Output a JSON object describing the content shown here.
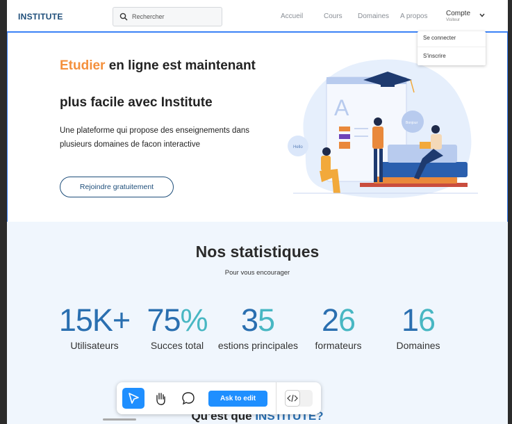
{
  "header": {
    "logo": "INSTITUTE",
    "search_placeholder": "Rechercher",
    "nav": [
      "Accueil",
      "Cours",
      "Domaines",
      "A propos"
    ],
    "account": {
      "title": "Compte",
      "subtitle": "Visiteur"
    },
    "dropdown": [
      "Se connecter",
      "S'inscrire"
    ]
  },
  "hero": {
    "title_accent": "Etudier",
    "title_rest": " en ligne est maintenant",
    "title_line2": "plus facile avec Institute",
    "description": "Une plateforme qui propose des enseignements dans plusieurs domaines de facon interactive",
    "cta": "Rejoindre gratuitement",
    "illustration_bubbles": [
      "Hello",
      "Bonjour"
    ]
  },
  "stats": {
    "title": "Nos statistiques",
    "subtitle": "Pour vous encourager",
    "items": [
      {
        "value_main": "15K+",
        "value_alt": "",
        "label": "Utilisateurs"
      },
      {
        "value_main": "75",
        "value_alt": "%",
        "label": "Succes total"
      },
      {
        "value_main": "3",
        "value_alt": "5",
        "label": "Questions principales"
      },
      {
        "value_main": "2",
        "value_alt": "6",
        "label": "formateurs"
      },
      {
        "value_main": "1",
        "value_alt": "6",
        "label": "Domaines"
      }
    ]
  },
  "next_section": {
    "title_start": "Qu'est que ",
    "title_accent": "INSTITUTE?"
  },
  "toolbar": {
    "ask_label": "Ask to edit",
    "icons": [
      "cursor-icon",
      "hand-icon",
      "comment-icon",
      "code-icon"
    ]
  },
  "colors": {
    "accent_orange": "#f4903c",
    "brand_blue": "#1e4e7a",
    "stat_blue": "#2a6fb0",
    "stat_teal": "#48b7c3",
    "toolbar_blue": "#1f8fff"
  }
}
